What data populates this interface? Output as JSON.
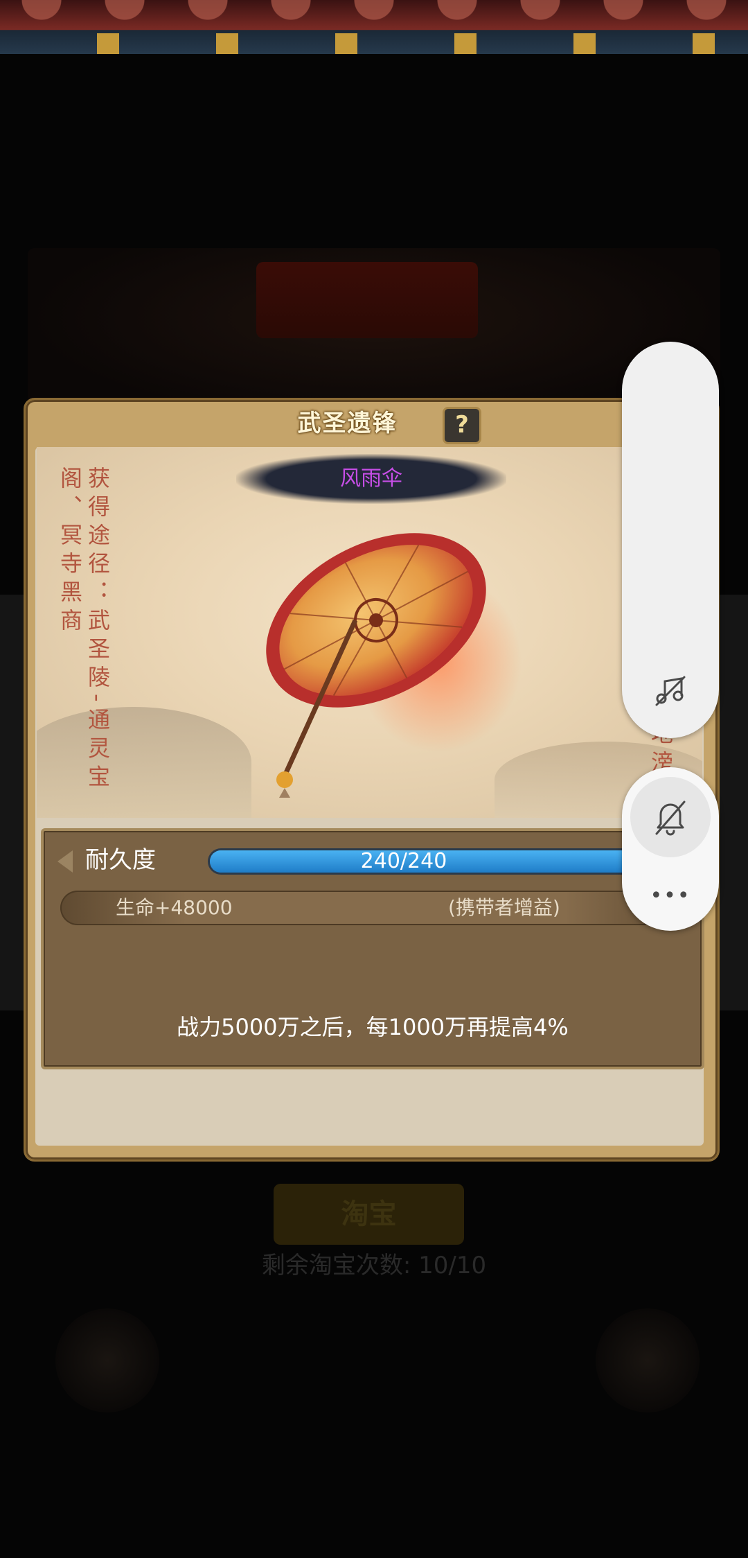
{
  "dialog": {
    "title": "武圣遗锋",
    "help_label": "?",
    "item_name": "风雨伞",
    "obtain_text": "获得途径：武圣陵-通灵宝阁、冥寺黑商",
    "description": "伞抵风挡雨，漫步天地滂沱。—通用—"
  },
  "durability": {
    "label": "耐久度",
    "value_text": "240/240",
    "current": 240,
    "max": 240
  },
  "stats": [
    {
      "name": "生命+48000",
      "note": "(携带者增益)"
    }
  ],
  "power_note": "战力5000万之后，每1000万再提高4%",
  "background": {
    "remaining_label": "剩余淘宝次数: 10/10",
    "button_label": "淘宝"
  },
  "floating_menu": {
    "icons": [
      "music-off-icon",
      "bell-off-icon",
      "more-icon"
    ],
    "more_label": "•••"
  },
  "colors": {
    "item_name": "#c64ee6",
    "side_text": "#b2553f",
    "durability_bar": "#2a8edb"
  }
}
